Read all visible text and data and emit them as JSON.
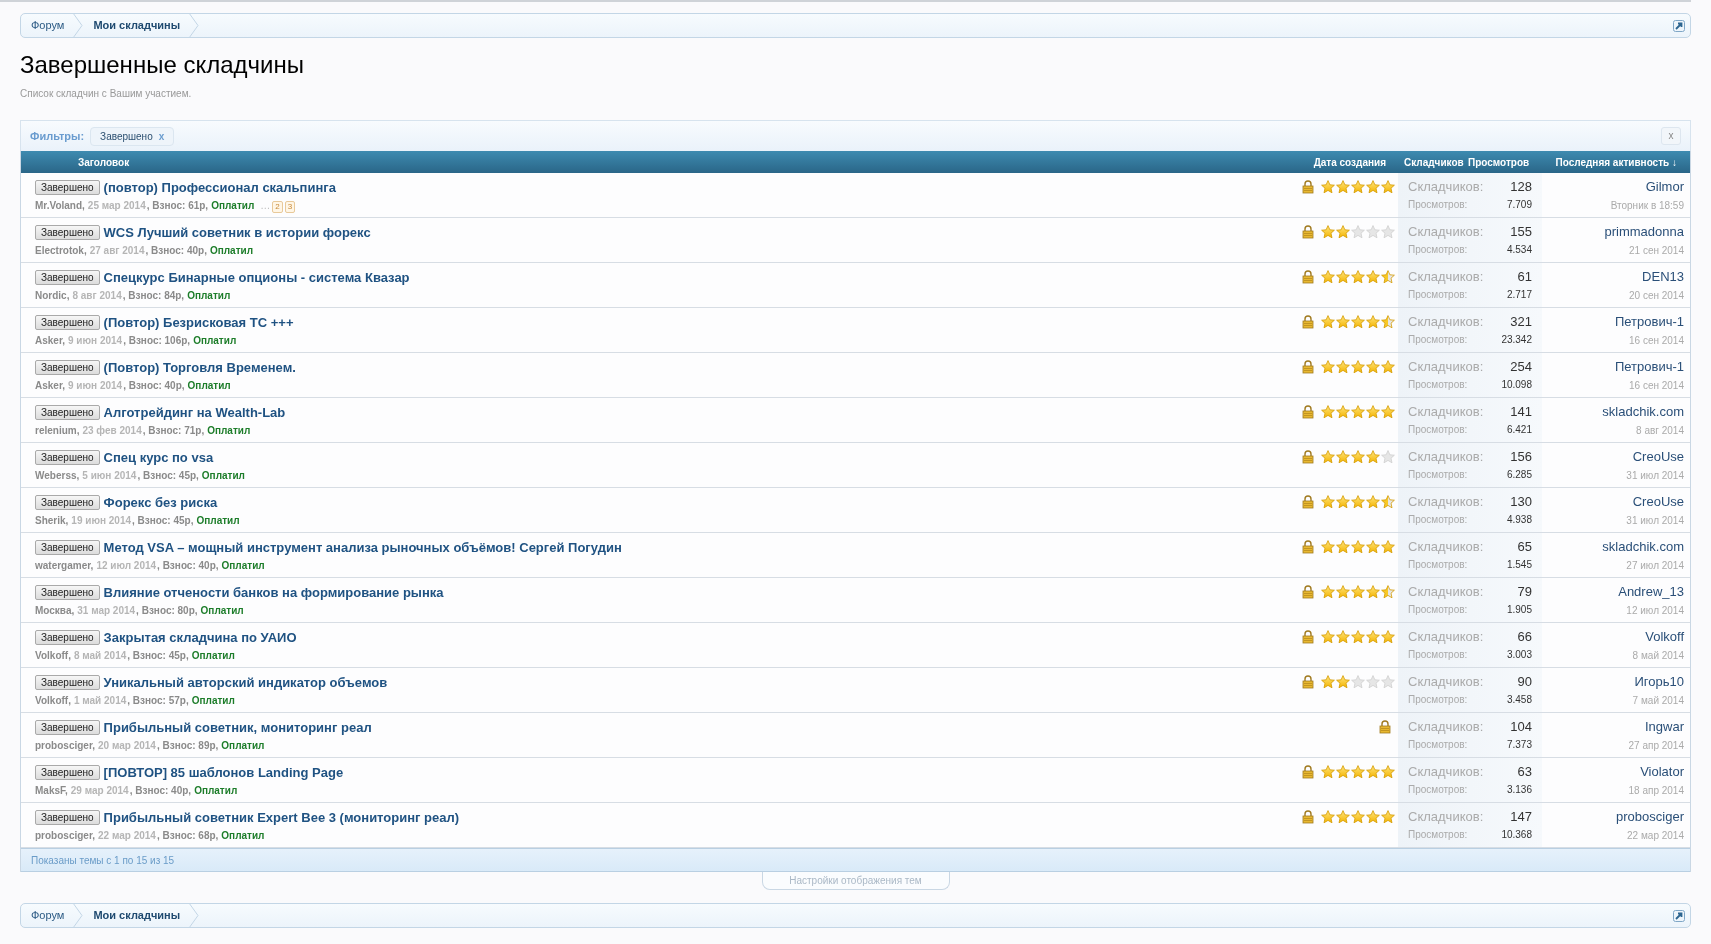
{
  "breadcrumb_top": [
    {
      "label": "Форум",
      "current": false
    },
    {
      "label": "Мои складчины",
      "current": true
    }
  ],
  "title": "Завершенные складчины",
  "subtitle": "Список складчин с Вашим участием.",
  "filters": {
    "label": "Фильтры:",
    "chips": [
      {
        "label": "Завершено",
        "remove": "x"
      }
    ],
    "clear": "x"
  },
  "columns": [
    {
      "label": "Заголовок",
      "kind": "title"
    },
    {
      "label": "Дата создания",
      "kind": "date"
    },
    {
      "label": "Складчиков",
      "kind": "participants"
    },
    {
      "label": "Просмотров",
      "kind": "views"
    },
    {
      "label": "Последняя активность ↓",
      "kind": "last"
    }
  ],
  "rows": [
    {
      "status": "Завершено",
      "title": "(повтор) Профессионал скальпинга",
      "author": "Mr.Voland,",
      "date": "25 мар 2014",
      "fee": ", Взнос: 61р,",
      "paid": "Оплатил",
      "ellipsis": "…",
      "pages": [
        "2",
        "3"
      ],
      "locked": true,
      "stars": 5,
      "participants_label": "Складчиков:",
      "participants": "128",
      "views_label": "Просмотров:",
      "views": "7.709",
      "last_user": "Gilmor",
      "last_date": "Вторник в 18:59"
    },
    {
      "status": "Завершено",
      "title": "WCS Лучший советник в истории форекс",
      "author": "Electrotok,",
      "date": "27 авг 2014",
      "fee": ", Взнос: 40р,",
      "paid": "Оплатил",
      "locked": true,
      "stars": 2,
      "participants_label": "Складчиков:",
      "participants": "155",
      "views_label": "Просмотров:",
      "views": "4.534",
      "last_user": "primmadonna",
      "last_date": "21 сен 2014"
    },
    {
      "status": "Завершено",
      "title": "Спецкурс Бинарные опционы - система Квазар",
      "author": "Nordic,",
      "date": "8 авг 2014",
      "fee": ", Взнос: 84р,",
      "paid": "Оплатил",
      "locked": true,
      "stars": 4.5,
      "participants_label": "Складчиков:",
      "participants": "61",
      "views_label": "Просмотров:",
      "views": "2.717",
      "last_user": "DEN13",
      "last_date": "20 сен 2014"
    },
    {
      "status": "Завершено",
      "title": "(Повтор) Безрисковая ТС +++",
      "author": "Asker,",
      "date": "9 июн 2014",
      "fee": ", Взнос: 106р,",
      "paid": "Оплатил",
      "locked": true,
      "stars": 4.5,
      "participants_label": "Складчиков:",
      "participants": "321",
      "views_label": "Просмотров:",
      "views": "23.342",
      "last_user": "Петрович-1",
      "last_date": "16 сен 2014"
    },
    {
      "status": "Завершено",
      "title": "(Повтор) Торговля Временем.",
      "author": "Asker,",
      "date": "9 июн 2014",
      "fee": ", Взнос: 40р,",
      "paid": "Оплатил",
      "locked": true,
      "stars": 5,
      "participants_label": "Складчиков:",
      "participants": "254",
      "views_label": "Просмотров:",
      "views": "10.098",
      "last_user": "Петрович-1",
      "last_date": "16 сен 2014"
    },
    {
      "status": "Завершено",
      "title": "Алготрейдинг на Wealth-Lab",
      "author": "relenium,",
      "date": "23 фев 2014",
      "fee": ", Взнос: 71р,",
      "paid": "Оплатил",
      "locked": true,
      "stars": 5,
      "participants_label": "Складчиков:",
      "participants": "141",
      "views_label": "Просмотров:",
      "views": "6.421",
      "last_user": "skladchik.com",
      "last_date": "8 авг 2014"
    },
    {
      "status": "Завершено",
      "title": "Спец курс по vsa",
      "author": "Weberss,",
      "date": "5 июн 2014",
      "fee": ", Взнос: 45р,",
      "paid": "Оплатил",
      "locked": true,
      "stars": 4,
      "participants_label": "Складчиков:",
      "participants": "156",
      "views_label": "Просмотров:",
      "views": "6.285",
      "last_user": "CreoUse",
      "last_date": "31 июл 2014"
    },
    {
      "status": "Завершено",
      "title": "Форекс без риска",
      "author": "Sherik,",
      "date": "19 июн 2014",
      "fee": ", Взнос: 45р,",
      "paid": "Оплатил",
      "locked": true,
      "stars": 4.5,
      "participants_label": "Складчиков:",
      "participants": "130",
      "views_label": "Просмотров:",
      "views": "4.938",
      "last_user": "CreoUse",
      "last_date": "31 июл 2014"
    },
    {
      "status": "Завершено",
      "title": "Метод VSA – мощный инструмент анализа рыночных объёмов! Сергей Погудин",
      "author": "watergamer,",
      "date": "12 июл 2014",
      "fee": ", Взнос: 40р,",
      "paid": "Оплатил",
      "locked": true,
      "stars": 5,
      "participants_label": "Складчиков:",
      "participants": "65",
      "views_label": "Просмотров:",
      "views": "1.545",
      "last_user": "skladchik.com",
      "last_date": "27 июл 2014"
    },
    {
      "status": "Завершено",
      "title": "Влияние отчености банков на формирование рынка",
      "author": "Москва,",
      "date": "31 мар 2014",
      "fee": ", Взнос: 80р,",
      "paid": "Оплатил",
      "locked": true,
      "stars": 4.5,
      "participants_label": "Складчиков:",
      "participants": "79",
      "views_label": "Просмотров:",
      "views": "1.905",
      "last_user": "Andrew_13",
      "last_date": "12 июл 2014"
    },
    {
      "status": "Завершено",
      "title": "Закрытая складчина по УАИО",
      "author": "Volkoff,",
      "date": "8 май 2014",
      "fee": ", Взнос: 45р,",
      "paid": "Оплатил",
      "locked": true,
      "stars": 5,
      "participants_label": "Складчиков:",
      "participants": "66",
      "views_label": "Просмотров:",
      "views": "3.003",
      "last_user": "Volkoff",
      "last_date": "8 май 2014"
    },
    {
      "status": "Завершено",
      "title": "Уникальный авторский индикатор объемов",
      "author": "Volkoff,",
      "date": "1 май 2014",
      "fee": ", Взнос: 57р,",
      "paid": "Оплатил",
      "locked": true,
      "stars": 2,
      "participants_label": "Складчиков:",
      "participants": "90",
      "views_label": "Просмотров:",
      "views": "3.458",
      "last_user": "Игорь10",
      "last_date": "7 май 2014"
    },
    {
      "status": "Завершено",
      "title": "Прибыльный советник, мониторинг реал",
      "author": "probosciger,",
      "date": "20 мар 2014",
      "fee": ", Взнос: 89р,",
      "paid": "Оплатил",
      "locked": true,
      "participants_label": "Складчиков:",
      "participants": "104",
      "views_label": "Просмотров:",
      "views": "7.373",
      "last_user": "Ingwar",
      "last_date": "27 апр 2014"
    },
    {
      "status": "Завершено",
      "title": "[ПОВТОР] 85 шаблонов Landing Page",
      "author": "MaksF,",
      "date": "29 мар 2014",
      "fee": ", Взнос: 40р,",
      "paid": "Оплатил",
      "locked": true,
      "stars": 5,
      "participants_label": "Складчиков:",
      "participants": "63",
      "views_label": "Просмотров:",
      "views": "3.136",
      "last_user": "Violator",
      "last_date": "18 апр 2014"
    },
    {
      "status": "Завершено",
      "title": "Прибыльный советник Expert Bee 3 (мониторинг реал)",
      "author": "probosciger,",
      "date": "22 мар 2014",
      "fee": ", Взнос: 68р,",
      "paid": "Оплатил",
      "locked": true,
      "stars": 5,
      "participants_label": "Складчиков:",
      "participants": "147",
      "views_label": "Просмотров:",
      "views": "10.368",
      "last_user": "probosciger",
      "last_date": "22 мар 2014"
    }
  ],
  "footer": "Показаны темы с 1 по 15 из 15",
  "display_settings": "Настройки отображения тем",
  "breadcrumb_bottom": [
    {
      "label": "Форум",
      "current": false
    },
    {
      "label": "Мои складчины",
      "current": true
    }
  ]
}
